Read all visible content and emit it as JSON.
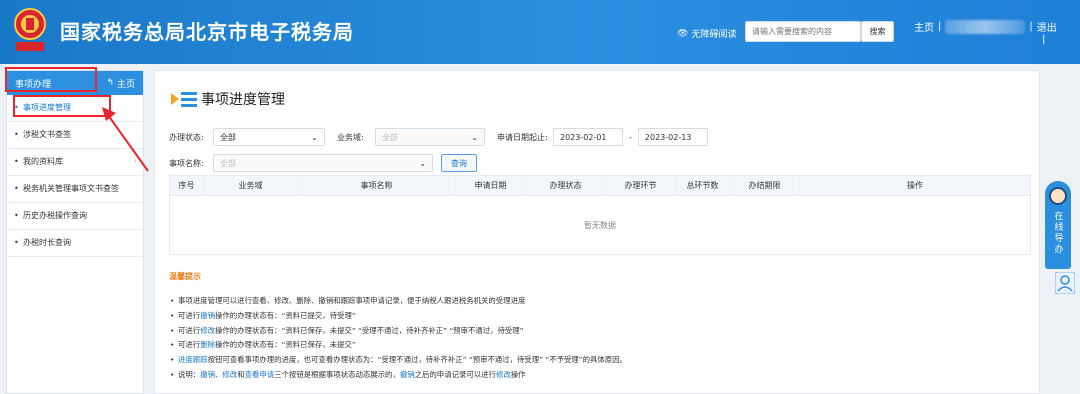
{
  "header": {
    "site_title": "国家税务总局北京市电子税务局",
    "emblem_text": "中国税务",
    "accessibility": "无障碍阅读",
    "search_placeholder": "请输入需要搜索的内容",
    "search_button": "搜索",
    "home_link": "主页",
    "divider": "|",
    "logout": "退出",
    "brand_color": "#2b8fe0"
  },
  "sidebar": {
    "section_title": "事项办理",
    "home_label": "主页",
    "items": [
      {
        "label": "事项进度管理",
        "active": true
      },
      {
        "label": "涉税文书查签"
      },
      {
        "label": "我的资料库"
      },
      {
        "label": "税务机关管理事项文书查签"
      },
      {
        "label": "历史办税操作查询"
      },
      {
        "label": "办税时长查询"
      }
    ]
  },
  "main": {
    "title": "事项进度管理",
    "filters": {
      "status_label": "办理状态:",
      "status_value": "全部",
      "domain_label": "业务域:",
      "domain_value": "全部",
      "date_label": "申请日期起止:",
      "date_start": "2023-02-01",
      "date_sep": "-",
      "date_end": "2023-02-13",
      "name_label": "事项名称:",
      "name_value": "全部",
      "query_button": "查询"
    },
    "table": {
      "headers": [
        "序号",
        "业务域",
        "事项名称",
        "申请日期",
        "办理状态",
        "办理环节",
        "总环节数",
        "办结期限",
        "操作"
      ],
      "empty_text": "暂无数据"
    },
    "tips": {
      "title": "温馨提示",
      "lines": [
        {
          "parts": [
            {
              "t": "事项进度管理可以进行查看、修改、删除、撤销和跟踪事项申请记录，便于纳税人跟进税务机关的受理进度"
            }
          ]
        },
        {
          "parts": [
            {
              "t": "可进行"
            },
            {
              "t": "撤销",
              "link": true
            },
            {
              "t": "操作的办理状态有：“资料已提交，待受理”"
            }
          ]
        },
        {
          "parts": [
            {
              "t": "可进行"
            },
            {
              "t": "修改",
              "link": true
            },
            {
              "t": "操作的办理状态有：“资料已保存，未提交”  “受理不通过，待补齐补正”  “预审不通过，待受理”"
            }
          ]
        },
        {
          "parts": [
            {
              "t": "可进行"
            },
            {
              "t": "删除",
              "link": true
            },
            {
              "t": "操作的办理状态有：“资料已保存，未提交”"
            }
          ]
        },
        {
          "parts": [
            {
              "t": "进度跟踪",
              "link": true
            },
            {
              "t": "按钮可查看事项办理的进度，也可查看办理状态为：“受理不通过，待补齐补正”  “预审不通过，待受理”  “不予受理”的具体原因。"
            }
          ]
        },
        {
          "parts": [
            {
              "t": "说明："
            },
            {
              "t": "撤销",
              "link": true
            },
            {
              "t": "、"
            },
            {
              "t": "修改",
              "link": true
            },
            {
              "t": "和"
            },
            {
              "t": "查看申请",
              "link": true
            },
            {
              "t": "三个按钮是根据事项状态动态展示的，"
            },
            {
              "t": "撤销",
              "link": true
            },
            {
              "t": "之后的申请记录可以进行"
            },
            {
              "t": "修改",
              "link": true
            },
            {
              "t": "操作"
            }
          ]
        }
      ]
    }
  },
  "float_panel": {
    "label": "在线导办"
  }
}
